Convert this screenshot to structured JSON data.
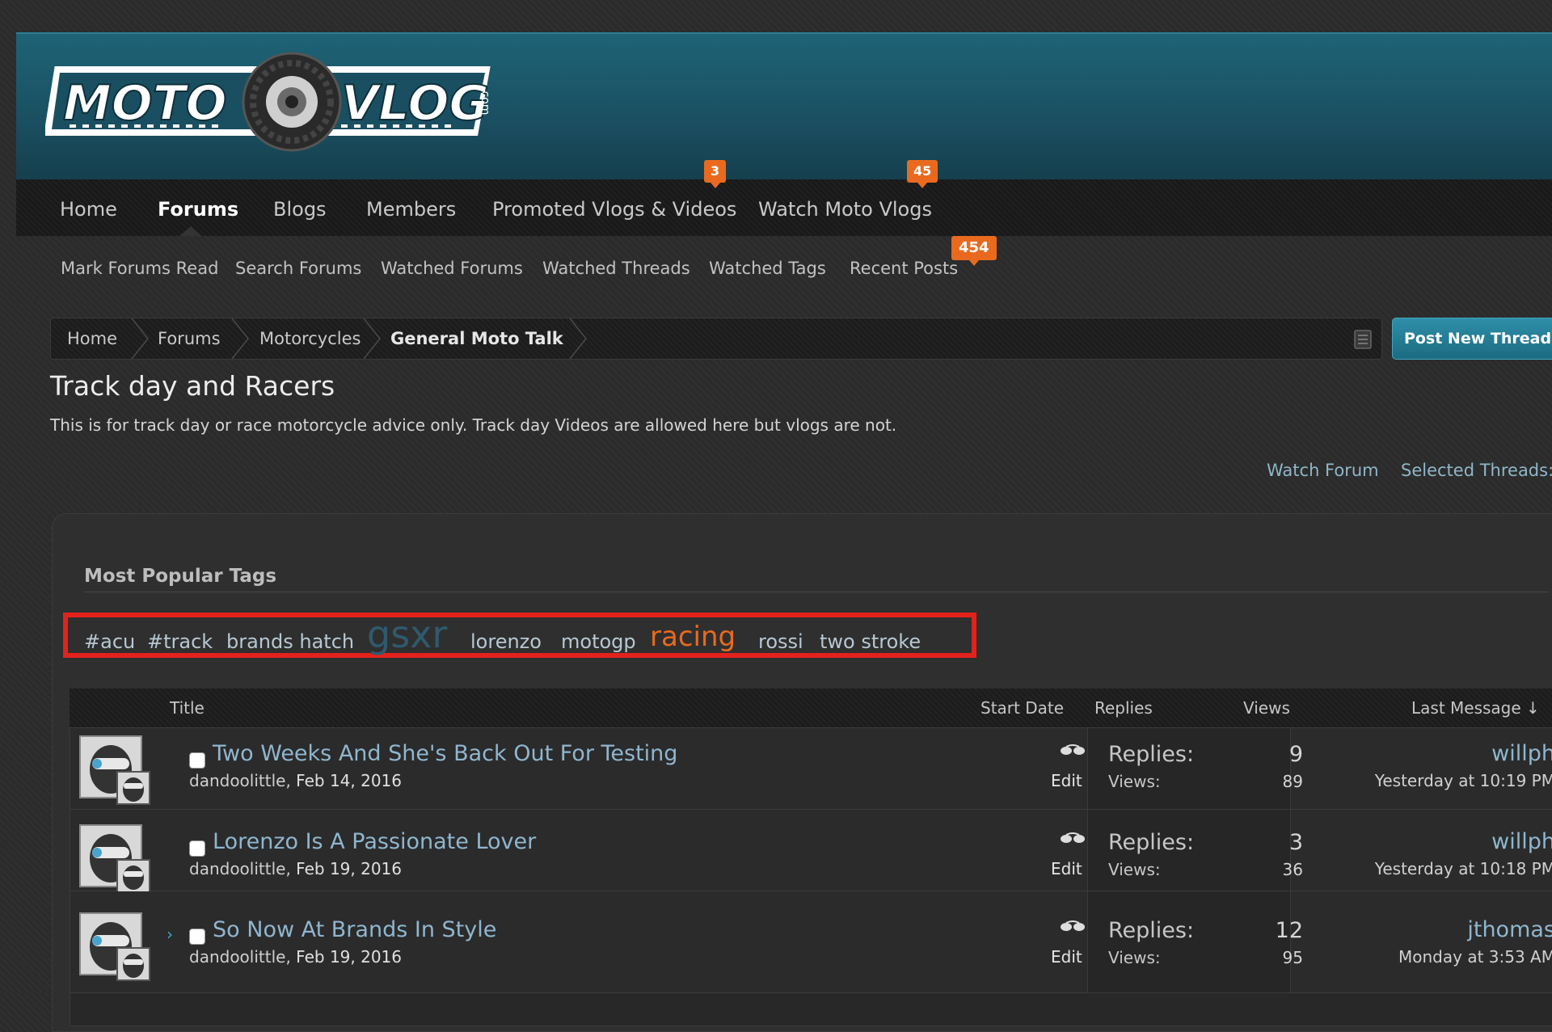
{
  "logo": {
    "left": "MOTO",
    "right": "VLOG",
    "suffix": ".com"
  },
  "nav": {
    "tabs": [
      {
        "label": "Home"
      },
      {
        "label": "Forums"
      },
      {
        "label": "Blogs"
      },
      {
        "label": "Members"
      },
      {
        "label": "Promoted Vlogs & Videos",
        "badge": "3"
      },
      {
        "label": "Watch Moto Vlogs",
        "badge": "45"
      }
    ]
  },
  "subnav": {
    "items": [
      {
        "label": "Mark Forums Read"
      },
      {
        "label": "Search Forums"
      },
      {
        "label": "Watched Forums"
      },
      {
        "label": "Watched Threads"
      },
      {
        "label": "Watched Tags"
      },
      {
        "label": "Recent Posts",
        "badge": "454"
      }
    ]
  },
  "breadcrumb": {
    "items": [
      "Home",
      "Forums",
      "Motorcycles",
      "General Moto Talk"
    ]
  },
  "post_button": "Post New Thread",
  "forum": {
    "title": "Track day and Racers",
    "description": "This is for track day or race motorcycle advice only. Track day Videos are allowed here but vlogs are not.",
    "watch_link": "Watch Forum",
    "selected_link": "Selected Threads:"
  },
  "tags": {
    "heading": "Most Popular Tags",
    "items": [
      {
        "label": "#acu"
      },
      {
        "label": "#track"
      },
      {
        "label": "brands hatch"
      },
      {
        "label": "gsxr"
      },
      {
        "label": "lorenzo"
      },
      {
        "label": "motogp"
      },
      {
        "label": "racing"
      },
      {
        "label": "rossi"
      },
      {
        "label": "two stroke"
      }
    ]
  },
  "table": {
    "headers": {
      "title": "Title",
      "start_date": "Start Date",
      "replies": "Replies",
      "views": "Views",
      "last_message": "Last Message ↓"
    },
    "rows": [
      {
        "title": "Two Weeks And She's Back Out For Testing",
        "author": "dandoolittle",
        "separator": ",",
        "date": "Feb 14, 2016",
        "edit": "Edit",
        "replies_label": "Replies:",
        "replies": "9",
        "views_label": "Views:",
        "views": "89",
        "last_user": "willph",
        "last_time": "Yesterday at 10:19 PM"
      },
      {
        "title": "Lorenzo Is A Passionate Lover",
        "author": "dandoolittle",
        "separator": ",",
        "date": "Feb 19, 2016",
        "edit": "Edit",
        "replies_label": "Replies:",
        "replies": "3",
        "views_label": "Views:",
        "views": "36",
        "last_user": "willph",
        "last_time": "Yesterday at 10:18 PM"
      },
      {
        "title": "So Now At Brands In Style",
        "author": "dandoolittle",
        "separator": ",",
        "date": "Feb 19, 2016",
        "edit": "Edit",
        "replies_label": "Replies:",
        "replies": "12",
        "views_label": "Views:",
        "views": "95",
        "last_user": "jthomas",
        "last_time": "Monday at 3:53 AM"
      }
    ]
  },
  "colors": {
    "accent_teal": "#1e6376",
    "badge_orange": "#e96a1e",
    "highlight_red": "#e3221c",
    "link_blue": "#8fb6cf"
  }
}
